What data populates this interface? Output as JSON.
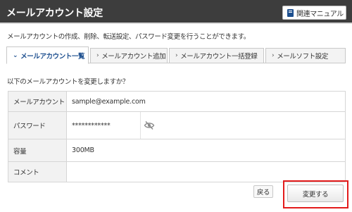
{
  "header": {
    "title": "メールアカウント設定",
    "manual_label": "関連マニュアル",
    "manual_icon": "book-icon"
  },
  "description": "メールアカウントの作成、削除、転送設定、パスワード変更を行うことができます。",
  "tabs": [
    {
      "label": "メールアカウント一覧",
      "active": true,
      "icon": "chevron-down-icon"
    },
    {
      "label": "メールアカウント追加",
      "active": false,
      "icon": "chevron-right-icon"
    },
    {
      "label": "メールアカウント一括登録",
      "active": false,
      "icon": "chevron-right-icon"
    },
    {
      "label": "メールソフト設定",
      "active": false,
      "icon": "chevron-right-icon"
    }
  ],
  "question": "以下のメールアカウントを変更しますか？",
  "form": {
    "account": {
      "label": "メールアカウント",
      "value": "sample@example.com"
    },
    "password": {
      "label": "パスワード",
      "value": "************",
      "toggle_icon": "eye-slash-icon"
    },
    "capacity": {
      "label": "容量",
      "value": "300MB"
    },
    "comment": {
      "label": "コメント",
      "value": ""
    }
  },
  "actions": {
    "back_label": "戻る",
    "submit_label": "変更する"
  },
  "colors": {
    "header_bg": "#3d3d3d",
    "accent": "#1d4f8f",
    "highlight": "#e31b1b"
  }
}
